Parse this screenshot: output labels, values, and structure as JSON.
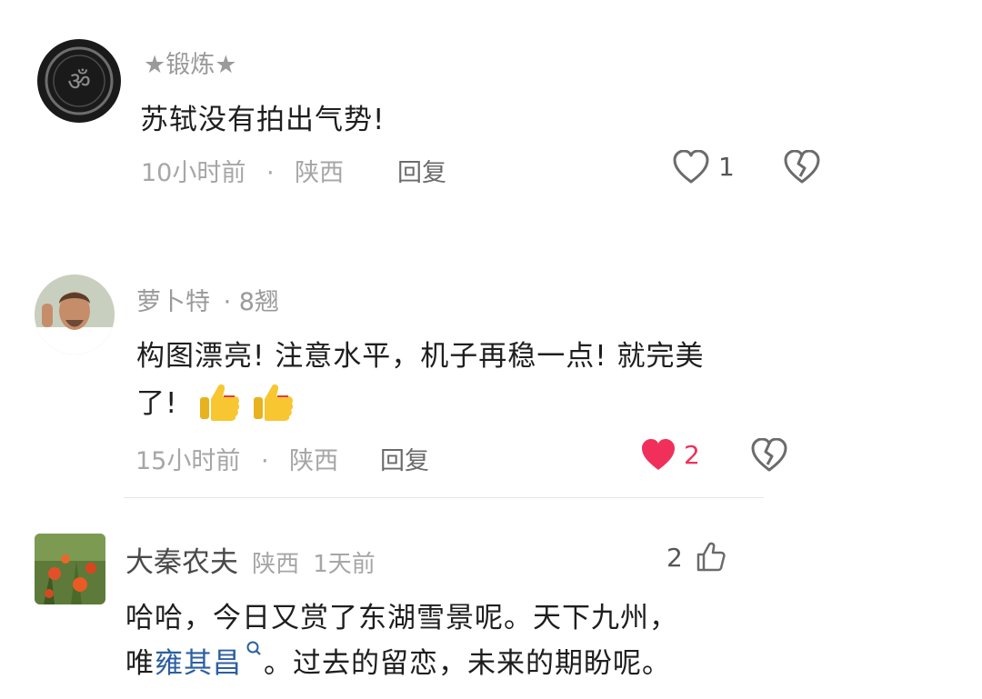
{
  "comments": [
    {
      "name": "★锻炼★",
      "text": "苏轼没有拍出气势!",
      "time": "10小时前",
      "sep": "·",
      "location": "陕西",
      "reply_label": "回复",
      "like_count": "1",
      "liked": false
    },
    {
      "name": "萝卜特",
      "level": "· 8翘",
      "text_line1": "构图漂亮! 注意水平，机子再稳一点! 就完美",
      "text_line2": "了!",
      "time": "15小时前",
      "sep": "·",
      "location": "陕西",
      "reply_label": "回复",
      "like_count": "2",
      "liked": true
    },
    {
      "name": "大秦农夫",
      "location": "陕西",
      "time": "1天前",
      "like_count": "2",
      "text_line1": "哈哈，今日又赏了东湖雪景呢。天下九州，",
      "text_line2_prefix": "唯",
      "text_link": "雍其昌",
      "text_line2_suffix": "。过去的留恋，未来的期盼呢。"
    }
  ],
  "colors": {
    "heart_liked": "#f0305a",
    "link": "#2d5fa0"
  },
  "icons": {
    "like": "heart-outline-icon",
    "liked": "heart-filled-icon",
    "dislike": "broken-heart-icon",
    "thumbs_up": "thumbs-up-icon",
    "search": "search-icon",
    "emoji": "thumbs-up-emoji"
  }
}
